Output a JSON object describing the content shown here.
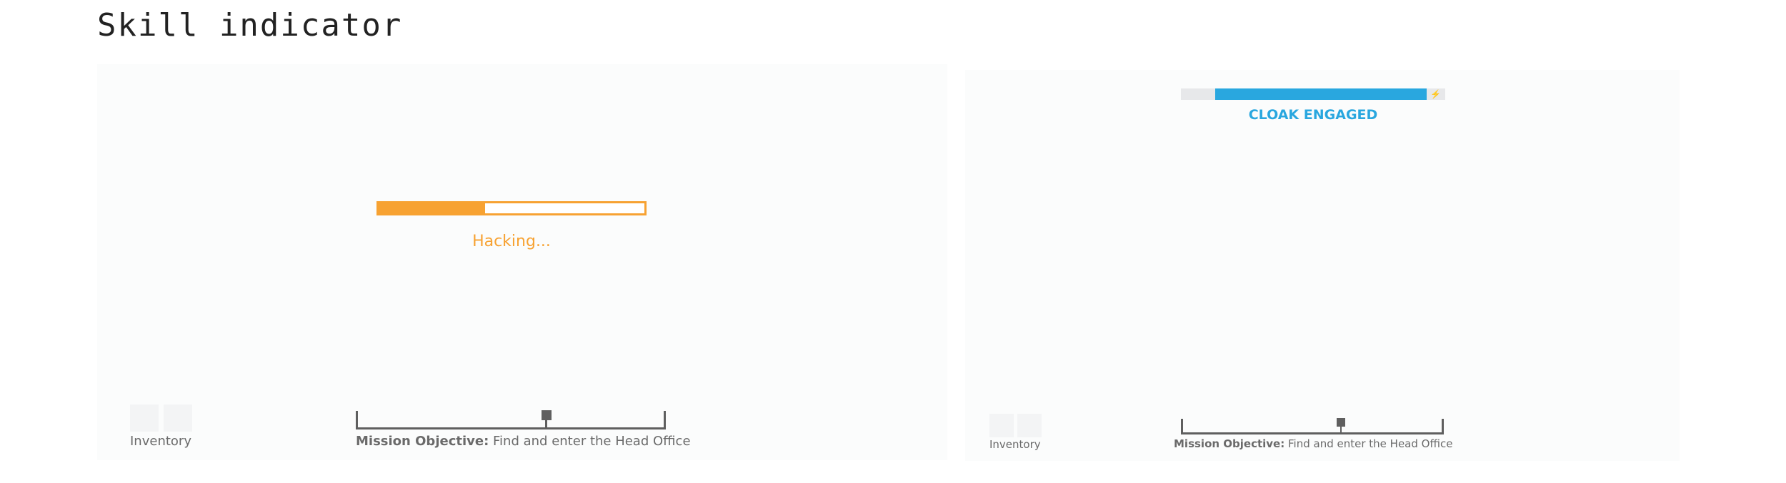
{
  "page": {
    "title": "Skill indicator"
  },
  "hacking": {
    "label": "Hacking...",
    "progress": 0.4,
    "color": "#f7a232"
  },
  "cloak": {
    "label": "CLOAK ENGAGED",
    "fill_start": 0.13,
    "fill_end": 0.93,
    "icon": "lightning-bolt-icon",
    "icon_glyph": "⚡",
    "color": "#29a7df"
  },
  "hud": {
    "inventory_label": "Inventory",
    "mission_prefix": "Mission Objective:",
    "mission_text": "Find and enter the Head Office",
    "mission_marker_position": 0.61
  },
  "colors": {
    "panel_bg": "#fbfcfc",
    "hud_grey": "#5f5f5f",
    "text_grey": "#6a6a6a"
  }
}
